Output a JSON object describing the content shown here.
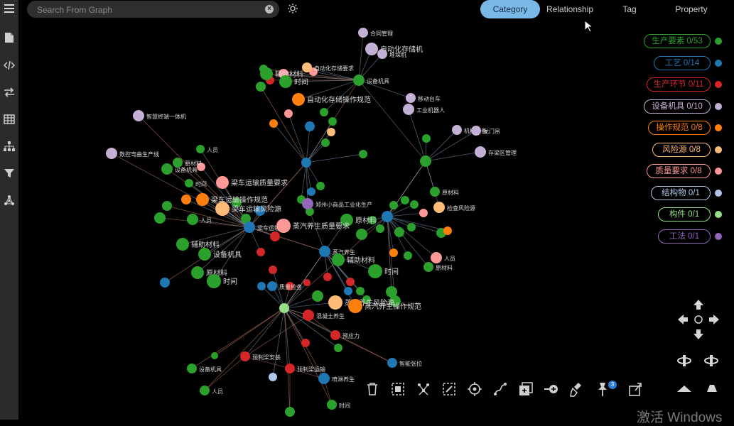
{
  "search": {
    "placeholder": "Search From Graph"
  },
  "tabs": [
    "Category",
    "Relationship",
    "Tag",
    "Property"
  ],
  "active_tab": "Category",
  "legend": [
    {
      "label": "生产要素 0/53",
      "color": "#2ca02c"
    },
    {
      "label": "工艺 0/14",
      "color": "#1f77b4"
    },
    {
      "label": "生产环节 0/11",
      "color": "#d62728"
    },
    {
      "label": "设备机具 0/10",
      "color": "#c5b0d5"
    },
    {
      "label": "操作规范 0/8",
      "color": "#ff7f0e"
    },
    {
      "label": "风险源 0/8",
      "color": "#ffbb78"
    },
    {
      "label": "质量要求 0/8",
      "color": "#ff9896"
    },
    {
      "label": "结构物 0/1",
      "color": "#aec7e8"
    },
    {
      "label": "构件 0/1",
      "color": "#98df8a"
    },
    {
      "label": "工法 0/1",
      "color": "#9467bd"
    }
  ],
  "sidebar_icons": [
    "menu-icon",
    "file-icon",
    "code-icon",
    "swap-icon",
    "table-icon",
    "hierarchy-icon",
    "filter-icon",
    "network-icon"
  ],
  "toolbar_icons": [
    "trash-icon",
    "select-box-icon",
    "expand-nodes-icon",
    "invert-selection-icon",
    "focus-target-icon",
    "path-icon",
    "add-node-icon",
    "add-edge-icon",
    "clean-icon",
    "pin-icon",
    "export-icon"
  ],
  "pin_count": "3",
  "watermark": "激活 Windows",
  "graph_labels": {
    "n1": "合同管理",
    "n2": "自动化存储机",
    "n3": "堆垛机",
    "n4": "自动化存储要求",
    "n5": "辅助材料",
    "n6": "时间",
    "n7": "设备机具",
    "n8": "自动化存储操作规范",
    "n9": "移动台车",
    "n10": "工业机器人",
    "n11": "智慧终端一体机",
    "n12": "人员",
    "n13": "数控弯曲生产线",
    "n14": "原材料",
    "n15": "设备机具",
    "n16": "时间",
    "n17": "梁车运输质量要求",
    "n18": "梁车运输操作规范",
    "n19": "梁车运输风险源",
    "n20": "人员",
    "n21": "郑州小商品工业化生产",
    "n22": "原材料",
    "n23": "检查风险源",
    "n24": "辅助材料",
    "n25": "设备机具",
    "n26": "梁车运输",
    "n27": "蒸汽养生质量要求",
    "n28": "蒸汽养生",
    "n29": "辅助材料",
    "n30": "时间",
    "n31": "原材料",
    "n32": "时间",
    "n33": "质量检查",
    "n34": "蒸汽养生风险源",
    "n35": "蒸汽养生操作规范",
    "n36": "混凝土养生",
    "n37": "预应力",
    "n38": "智能张拉",
    "n39": "预制梁安装",
    "n40": "人员",
    "n41": "预制梁运输",
    "n42": "喷淋养生",
    "n43": "时间",
    "n44": "设备机具",
    "n45": "存梁区管理",
    "n46": "原材料",
    "n47": "机械设备",
    "n48": "龙门吊",
    "n49": "人员",
    "n50": "原材料"
  }
}
